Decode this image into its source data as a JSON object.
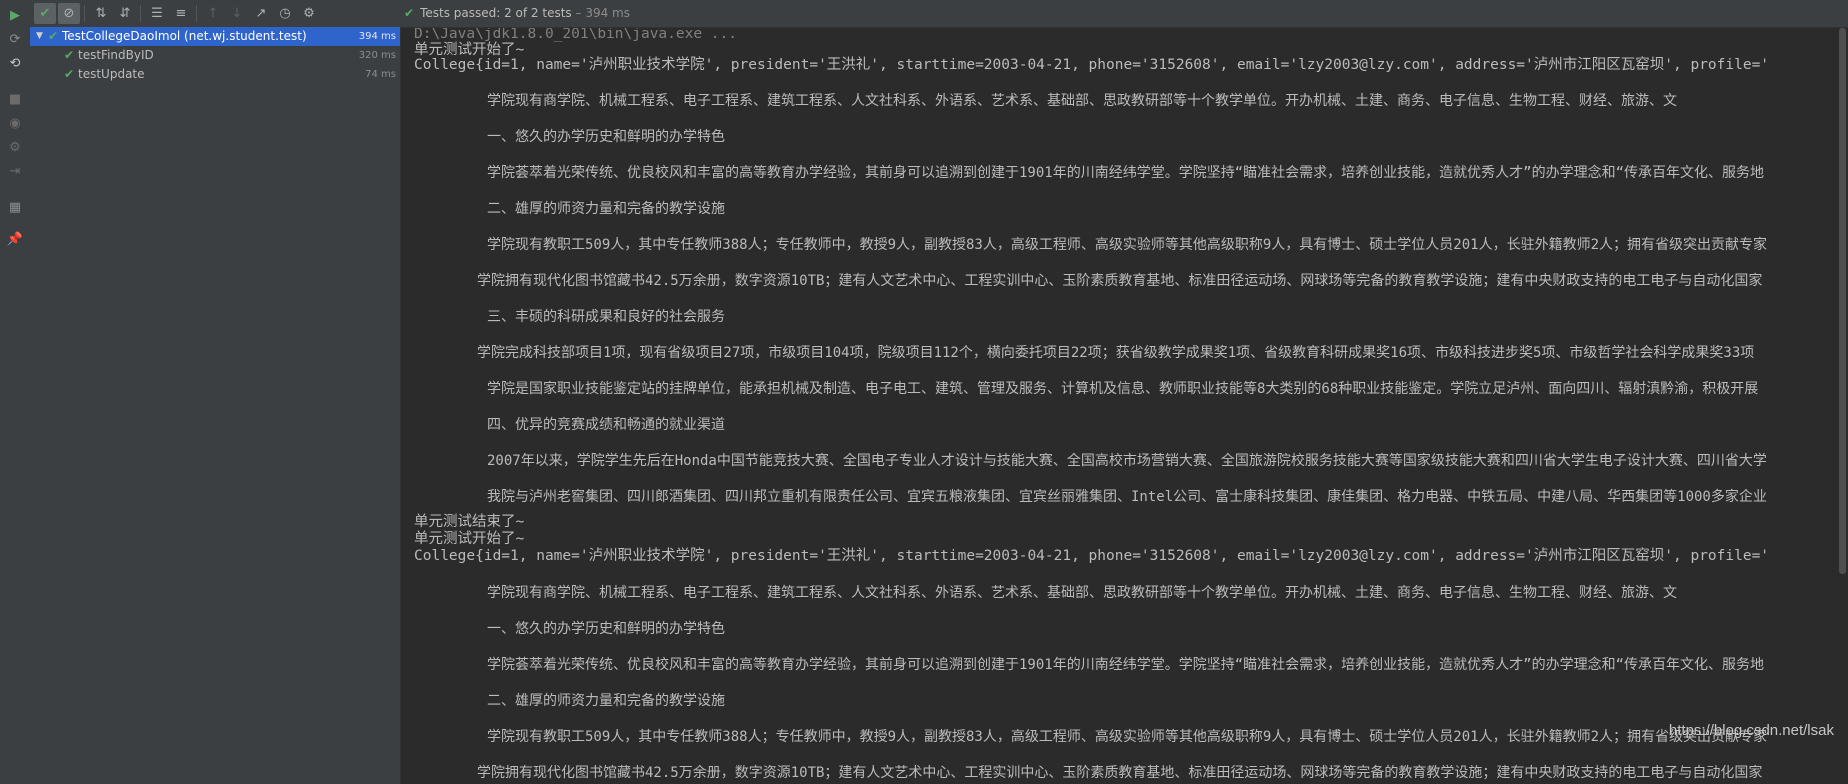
{
  "toolbar": {
    "status_text": "Tests passed: 2 of 2 tests",
    "status_duration": "– 394 ms"
  },
  "tree": {
    "root": {
      "name": "TestCollegeDaoImol (net.wj.student.test)",
      "time": "394 ms"
    },
    "children": [
      {
        "name": "testFindByID",
        "time": "320 ms"
      },
      {
        "name": "testUpdate",
        "time": "74 ms"
      }
    ]
  },
  "console": {
    "lines": [
      "D:\\Java\\jdk1.8.0_201\\bin\\java.exe ...",
      "单元测试开始了~",
      "College{id=1, name='泸州职业技术学院', president='王洪礼', starttime=2003-04-21, phone='3152608', email='lzy2003@lzy.com', address='泸州市江阳区瓦窑坝', profile='",
      "学院现有商学院、机械工程系、电子工程系、建筑工程系、人文社科系、外语系、艺术系、基础部、思政教研部等十个教学单位。开办机械、土建、商务、电子信息、生物工程、财经、旅游、文",
      "一、悠久的办学历史和鲜明的办学特色",
      "学院荟萃着光荣传统、优良校风和丰富的高等教育办学经验，其前身可以追溯到创建于1901年的川南经纬学堂。学院坚持“瞄准社会需求，培养创业技能，造就优秀人才”的办学理念和“传承百年文化、服务地",
      "二、雄厚的师资力量和完备的教学设施",
      "学院现有教职工509人，其中专任教师388人；专任教师中，教授9人，副教授83人，高级工程师、高级实验师等其他高级职称9人，具有博士、硕士学位人员201人，长驻外籍教师2人；拥有省级突出贡献专家",
      "学院拥有现代化图书馆藏书42.5万余册，数字资源10TB；建有人文艺术中心、工程实训中心、玉阶素质教育基地、标准田径运动场、网球场等完备的教育教学设施；建有中央财政支持的电工电子与自动化国家",
      "三、丰硕的科研成果和良好的社会服务",
      "学院完成科技部项目1项，现有省级项目27项，市级项目104项，院级项目112个，横向委托项目22项；获省级教学成果奖1项、省级教育科研成果奖16项、市级科技进步奖5项、市级哲学社会科学成果奖33项",
      "学院是国家职业技能鉴定站的挂牌单位，能承担机械及制造、电子电工、建筑、管理及服务、计算机及信息、教师职业技能等8大类别的68种职业技能鉴定。学院立足泸州、面向四川、辐射滇黔渝，积极开展",
      "四、优异的竞赛成绩和畅通的就业渠道",
      "2007年以来，学院学生先后在Honda中国节能竞技大赛、全国电子专业人才设计与技能大赛、全国高校市场营销大赛、全国旅游院校服务技能大赛等国家级技能大赛和四川省大学生电子设计大赛、四川省大学",
      "我院与泸州老窖集团、四川郎酒集团、四川邦立重机有限责任公司、宜宾五粮液集团、宜宾丝丽雅集团、Intel公司、富士康科技集团、康佳集团、格力电器、中铁五局、中建八局、华西集团等1000多家企业",
      "单元测试结束了~",
      "单元测试开始了~",
      "College{id=1, name='泸州职业技术学院', president='王洪礼', starttime=2003-04-21, phone='3152608', email='lzy2003@lzy.com', address='泸州市江阳区瓦窑坝', profile='",
      "学院现有商学院、机械工程系、电子工程系、建筑工程系、人文社科系、外语系、艺术系、基础部、思政教研部等十个教学单位。开办机械、土建、商务、电子信息、生物工程、财经、旅游、文",
      "一、悠久的办学历史和鲜明的办学特色",
      "学院荟萃着光荣传统、优良校风和丰富的高等教育办学经验，其前身可以追溯到创建于1901年的川南经纬学堂。学院坚持“瞄准社会需求，培养创业技能，造就优秀人才”的办学理念和“传承百年文化、服务地",
      "二、雄厚的师资力量和完备的教学设施",
      "学院现有教职工509人，其中专任教师388人；专任教师中，教授9人，副教授83人，高级工程师、高级实验师等其他高级职称9人，具有博士、硕士学位人员201人，长驻外籍教师2人；拥有省级突出贡献专家",
      "学院拥有现代化图书馆藏书42.5万余册，数字资源10TB；建有人文艺术中心、工程实训中心、玉阶素质教育基地、标准田径运动场、网球场等完备的教育教学设施；建有中央财政支持的电工电子与自动化国家"
    ]
  },
  "watermark": "https://blog.csdn.net/lsak"
}
